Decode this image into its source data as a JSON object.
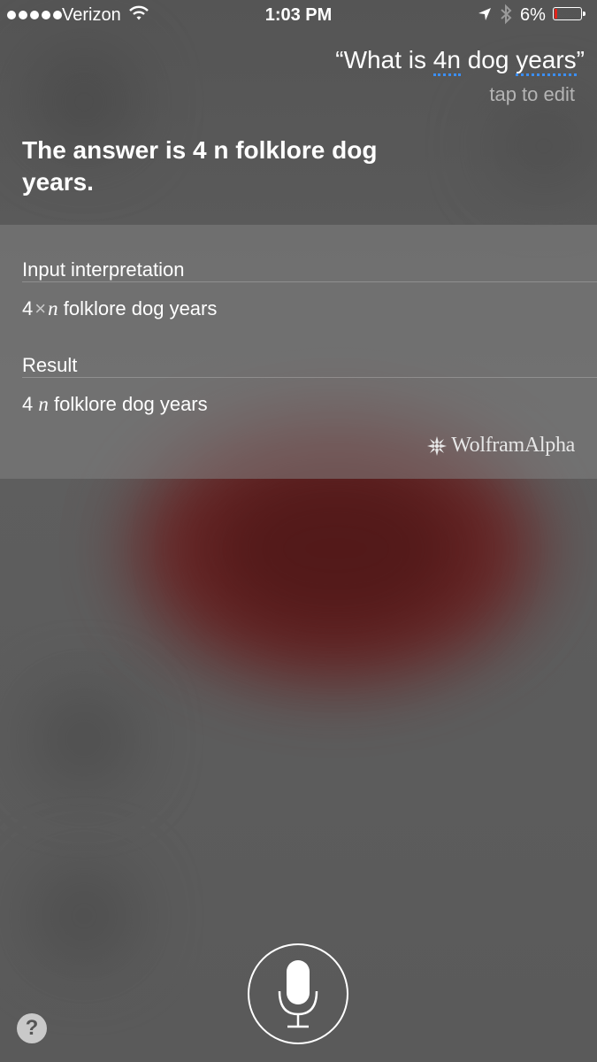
{
  "status_bar": {
    "carrier": "Verizon",
    "time": "1:03 PM",
    "battery_percent": "6%",
    "battery_level": 0.06,
    "battery_color": "#e0241b",
    "signal_dots": 5,
    "icons": [
      "wifi-icon",
      "location-arrow-icon",
      "bluetooth-icon",
      "battery-icon"
    ]
  },
  "query": {
    "open_quote": "“",
    "prefix": "What is ",
    "word1": "4n",
    "space": " dog ",
    "word2": "years",
    "close_quote": "”",
    "tap_to_edit": "tap to edit",
    "underline_color": "#3b8ff5"
  },
  "answer": "The answer is 4 n folklore dog years.",
  "wolfram": {
    "input_label": "Input interpretation",
    "input_num": "4",
    "input_times": "×",
    "input_var": "n",
    "input_rest": " folklore dog years",
    "result_label": "Result",
    "result_num": "4",
    "result_var": "n",
    "result_rest": " folklore dog years",
    "logo_text": "WolframAlpha"
  },
  "help_label": "?"
}
